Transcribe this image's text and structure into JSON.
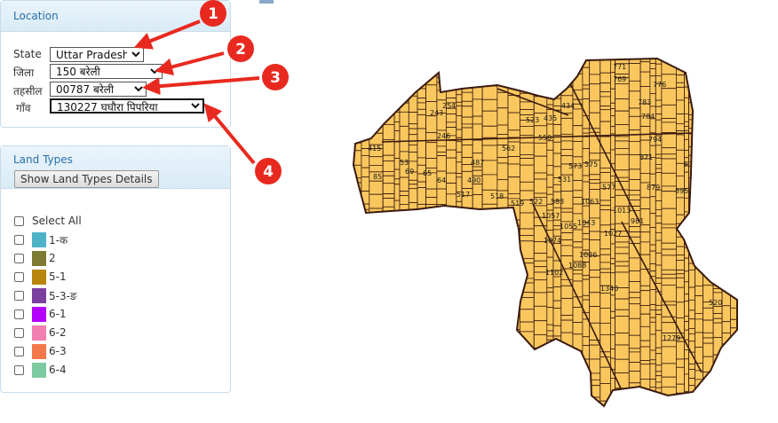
{
  "location": {
    "title": "Location",
    "state_label": "State",
    "state_value": "Uttar Pradesh",
    "district_label": "जिला",
    "district_value": "150 बरेली",
    "tehsil_label": "तहसील",
    "tehsil_value": "00787 बरेली",
    "village_label": "गाँव",
    "village_value": "130227 घघौरा पिपरिया"
  },
  "land_types": {
    "title": "Land Types",
    "show_button": "Show Land Types Details",
    "select_all": "Select All",
    "items": [
      {
        "label": "1-क",
        "color": "#4fb3c8"
      },
      {
        "label": "2",
        "color": "#7d7b32"
      },
      {
        "label": "5-1",
        "color": "#b8860b"
      },
      {
        "label": "5-3-ङ",
        "color": "#7b3fa0"
      },
      {
        "label": "6-1",
        "color": "#b400ff"
      },
      {
        "label": "6-2",
        "color": "#f27fb2"
      },
      {
        "label": "6-3",
        "color": "#f2784b"
      },
      {
        "label": "6-4",
        "color": "#7ecba1"
      }
    ]
  },
  "annotations": [
    "1",
    "2",
    "3",
    "4"
  ],
  "map": {
    "fill_color": "#f9c75e",
    "line_color": "#3a1a0f",
    "plot_labels": [
      "771",
      "769",
      "776",
      "783",
      "784",
      "794",
      "871",
      "839",
      "879",
      "895",
      "981",
      "1074",
      "1086",
      "1088",
      "1102",
      "1340",
      "1279",
      "520",
      "487",
      "573",
      "575",
      "577",
      "583",
      "531",
      "490",
      "517",
      "518",
      "519",
      "522",
      "562",
      "550",
      "523",
      "434",
      "435",
      "243",
      "254",
      "246",
      "53",
      "64",
      "69",
      "65",
      "85",
      "415",
      "1055",
      "1057",
      "1063",
      "1043",
      "1027",
      "1013"
    ]
  }
}
